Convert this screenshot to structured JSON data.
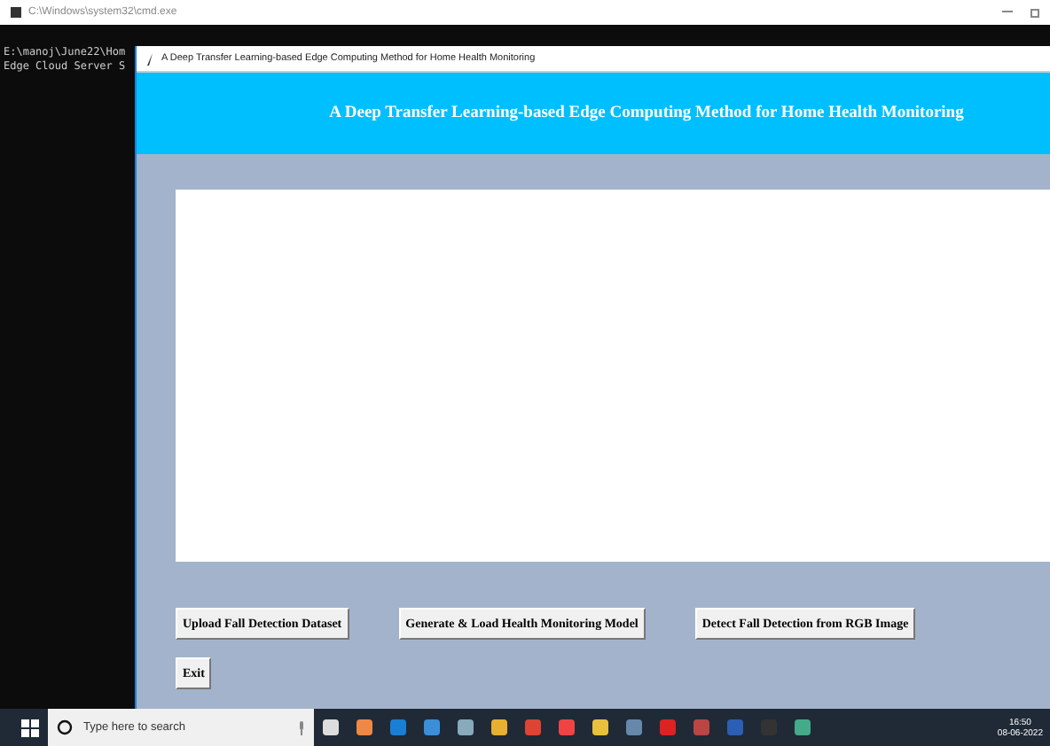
{
  "console_window": {
    "title": "C:\\Windows\\system32\\cmd.exe",
    "lines": [
      "E:\\manoj\\June22\\Hom",
      "Edge Cloud Server S"
    ]
  },
  "app_window": {
    "title": "A Deep Transfer Learning-based Edge Computing Method for Home Health Monitoring",
    "header": "A Deep Transfer Learning-based Edge Computing Method for Home Health Monitoring",
    "buttons": [
      {
        "label": "Upload Fall Detection Dataset"
      },
      {
        "label": "Generate & Load Health Monitoring Model"
      },
      {
        "label": "Detect Fall Detection from RGB Image"
      }
    ],
    "exit_button": "Exit"
  },
  "taskbar": {
    "search": {
      "placeholder": "Type here to search"
    },
    "time": "16:50",
    "date": "08-06-2022"
  }
}
